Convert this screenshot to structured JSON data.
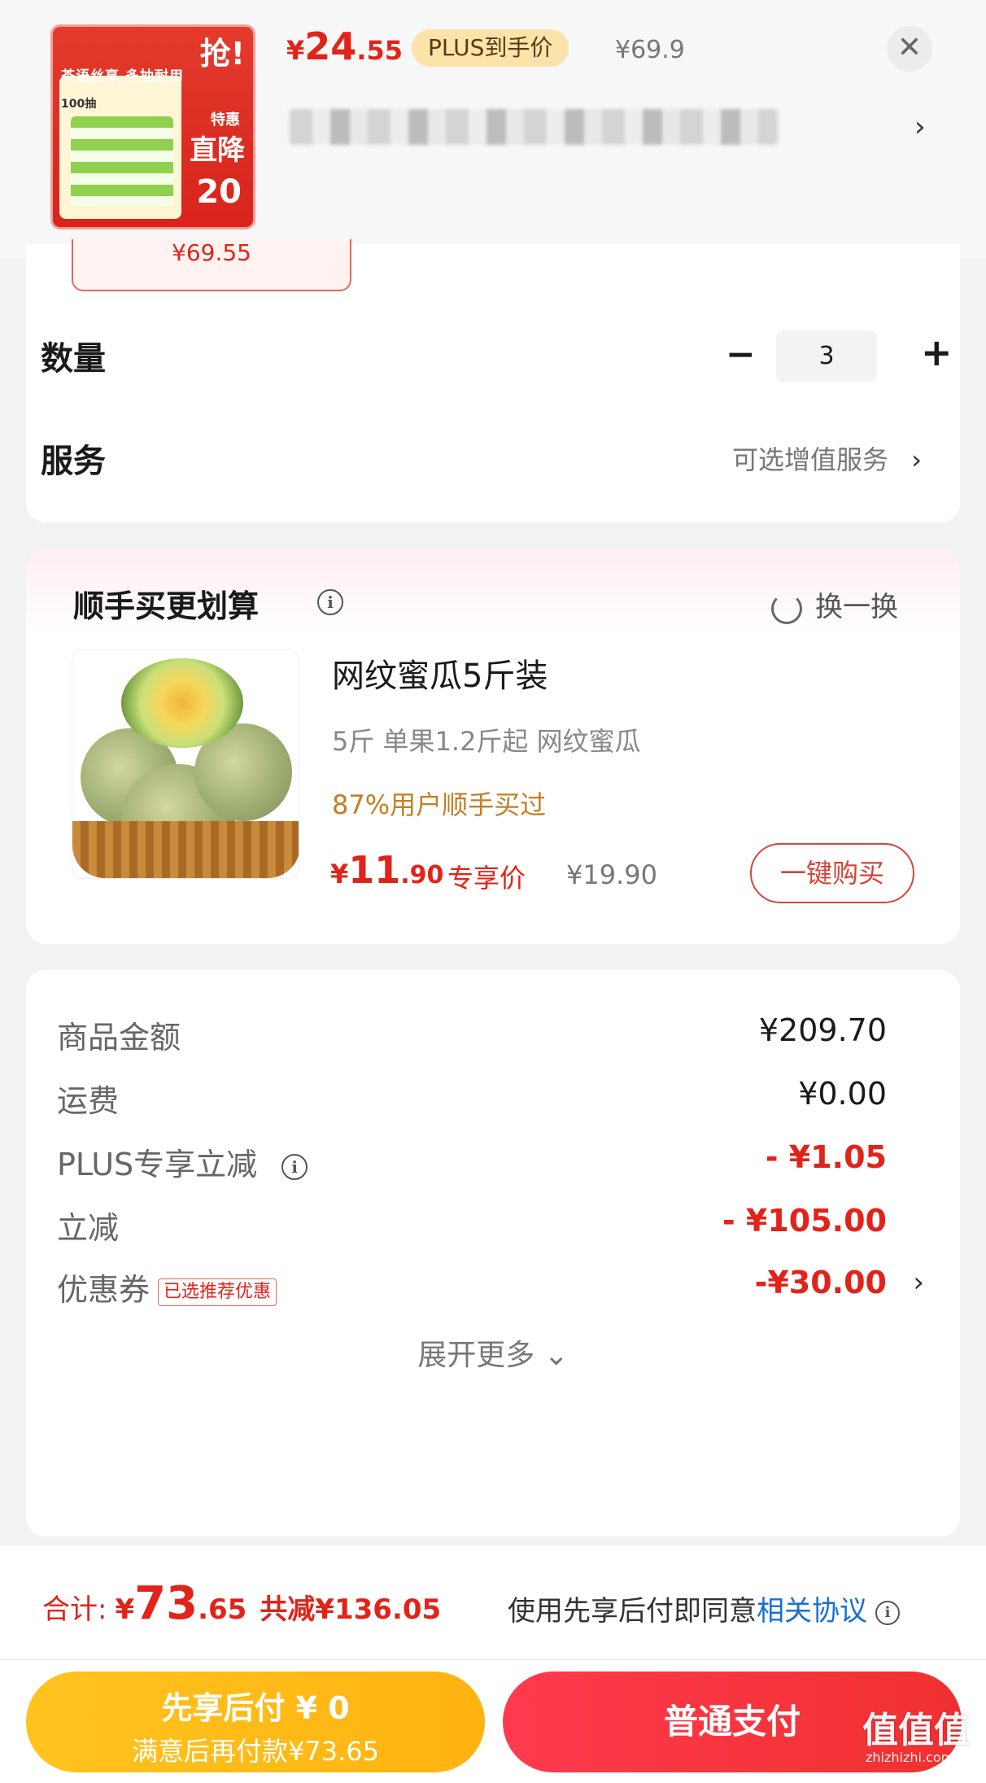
{
  "header": {
    "thumb_text": {
      "top": "抢!",
      "slogan": "茶语丝享 多抽耐用",
      "count": "100抽",
      "deal": "特惠",
      "drop": "直降",
      "number": "20"
    },
    "price_currency": "¥",
    "price_int": "24",
    "price_dec": ".55",
    "plus_badge": "PLUS到手价",
    "original_price": "¥69.9",
    "close_icon": "✕",
    "chevron": "›"
  },
  "spec": {
    "chip_price": "¥69.55"
  },
  "quantity": {
    "label": "数量",
    "minus": "−",
    "value": "3",
    "plus": "+"
  },
  "service": {
    "label": "服务",
    "link": "可选增值服务",
    "chevron": "›"
  },
  "recommend": {
    "title": "顺手买更划算",
    "info": "i",
    "swap": "换一换",
    "product": {
      "name": "网纹蜜瓜5斤装",
      "spec": "5斤 单果1.2斤起 网纹蜜瓜",
      "stat": "87%用户顺手买过",
      "price_currency": "¥",
      "price_int": "11",
      "price_dec": ".90",
      "price_tag": "专享价",
      "original_price": "¥19.90",
      "buy_button": "一键购买"
    }
  },
  "amounts": {
    "rows": [
      {
        "label": "商品金额",
        "value": "¥209.70"
      },
      {
        "label": "运费",
        "value": "¥0.00"
      },
      {
        "label": "PLUS专享立减",
        "value": "- ¥1.05"
      },
      {
        "label": "立减",
        "value": "- ¥105.00"
      },
      {
        "label": "优惠券",
        "value": "-¥30.00"
      }
    ],
    "coupon_tag": "已选推荐优惠",
    "coupon_chevron": "›",
    "expand": "展开更多 ⌄"
  },
  "bottom": {
    "total_label": "合计:",
    "total_currency": "¥",
    "total_int": "73",
    "total_dec": ".65",
    "total_saved": "共减¥136.05",
    "agree_text": "使用先享后付即同意",
    "agree_link": "相关协议",
    "later_line1": "先享后付 ¥ 0",
    "later_line2": "满意后再付款¥73.65",
    "pay_button": "普通支付"
  },
  "watermark": {
    "main": "值值值",
    "sub": "zhizhizhi.com"
  },
  "colors": {
    "accent_red": "#e2231a",
    "plus_gold": "#fbe3a9",
    "later_yellow": "#ffb310",
    "pay_red": "#f0302f",
    "link_blue": "#1a6fd1"
  }
}
